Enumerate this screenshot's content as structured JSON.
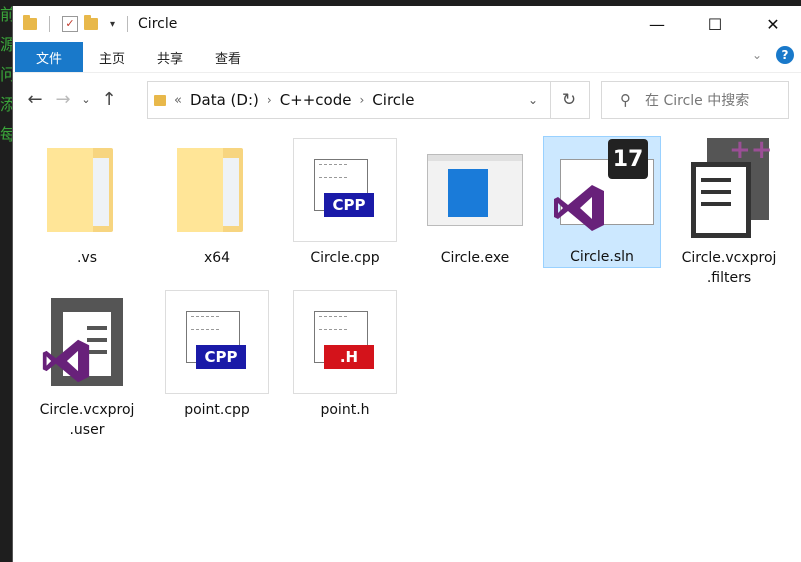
{
  "background": {
    "lines": [
      "前",
      "源",
      "问",
      "添",
      "每"
    ]
  },
  "window": {
    "title": "Circle"
  },
  "titlebar": {
    "minimize": "—",
    "maximize": "☐",
    "close": "✕"
  },
  "ribbon": {
    "file_tab": "文件",
    "tabs": [
      "主页",
      "共享",
      "查看"
    ],
    "help": "?"
  },
  "address": {
    "overflow": "«",
    "crumbs": [
      "Data (D:)",
      "C++code",
      "Circle"
    ]
  },
  "search": {
    "placeholder": "在 Circle 中搜索"
  },
  "files": [
    {
      "name": ".vs",
      "type": "folder"
    },
    {
      "name": "x64",
      "type": "folder"
    },
    {
      "name": "Circle.cpp",
      "type": "cpp",
      "badge": "CPP"
    },
    {
      "name": "Circle.exe",
      "type": "exe"
    },
    {
      "name": "Circle.sln",
      "type": "sln",
      "badge": "17",
      "selected": true
    },
    {
      "name": "Circle.vcxproj.filters",
      "type": "filters",
      "badge": "++"
    },
    {
      "name": "Circle.vcxproj.user",
      "type": "vcxproj"
    },
    {
      "name": "point.cpp",
      "type": "cpp",
      "badge": "CPP"
    },
    {
      "name": "point.h",
      "type": "h",
      "badge": ".H"
    }
  ],
  "colors": {
    "accent": "#1979ca",
    "selection": "#cce8ff",
    "vs_purple": "#68217a",
    "cpp_blue": "#1a1aa8",
    "h_red": "#d4131b"
  }
}
